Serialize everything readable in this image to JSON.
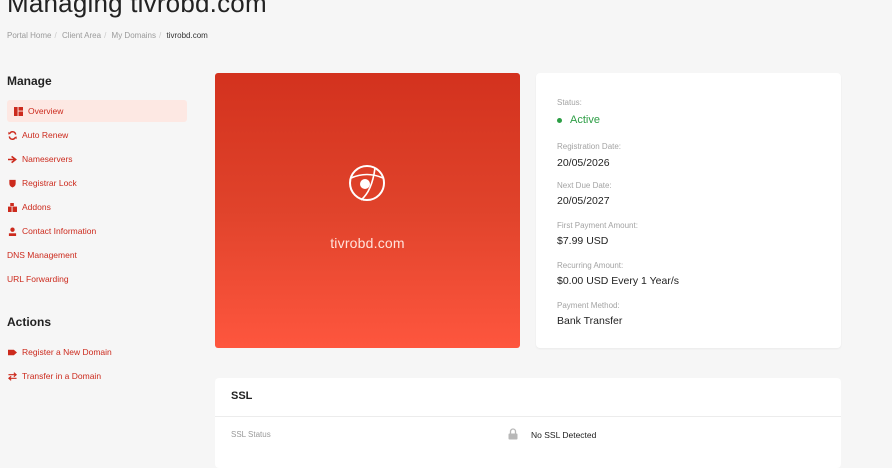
{
  "page": {
    "title": "Managing tivrobd.com"
  },
  "breadcrumb": [
    "Portal Home",
    "Client Area",
    "My Domains",
    "tivrobd.com"
  ],
  "sidebar": {
    "manage_heading": "Manage",
    "manage_items": [
      {
        "label": "Overview",
        "icon": "dashboard-icon",
        "active": true
      },
      {
        "label": "Auto Renew",
        "icon": "refresh-icon"
      },
      {
        "label": "Nameservers",
        "icon": "arrow-right-icon"
      },
      {
        "label": "Registrar Lock",
        "icon": "shield-icon"
      },
      {
        "label": "Addons",
        "icon": "cubes-icon"
      },
      {
        "label": "Contact Information",
        "icon": "user-icon"
      },
      {
        "label": "DNS Management"
      },
      {
        "label": "URL Forwarding"
      }
    ],
    "actions_heading": "Actions",
    "action_items": [
      {
        "label": "Register a New Domain",
        "icon": "tag-icon"
      },
      {
        "label": "Transfer in a Domain",
        "icon": "exchange-icon"
      }
    ]
  },
  "hero": {
    "domain": "tivrobd.com",
    "icon": "globe-icon"
  },
  "info": {
    "status_label": "Status:",
    "status_value": "Active",
    "registration_label": "Registration Date:",
    "registration_value": "20/05/2026",
    "next_due_label": "Next Due Date:",
    "next_due_value": "20/05/2027",
    "first_payment_label": "First Payment Amount:",
    "first_payment_value": "$7.99 USD",
    "recurring_label": "Recurring Amount:",
    "recurring_value": "$0.00 USD Every 1 Year/s",
    "payment_method_label": "Payment Method:",
    "payment_method_value": "Bank Transfer"
  },
  "ssl": {
    "title": "SSL",
    "status_label": "SSL Status",
    "status_value": "No SSL Detected",
    "icon": "lock-icon"
  },
  "colors": {
    "accent": "#cc2a1d",
    "active_bg": "#fde8e3",
    "status_green": "#2c9e45",
    "hero_top": "#d3321e",
    "hero_bottom": "#fe563e"
  }
}
